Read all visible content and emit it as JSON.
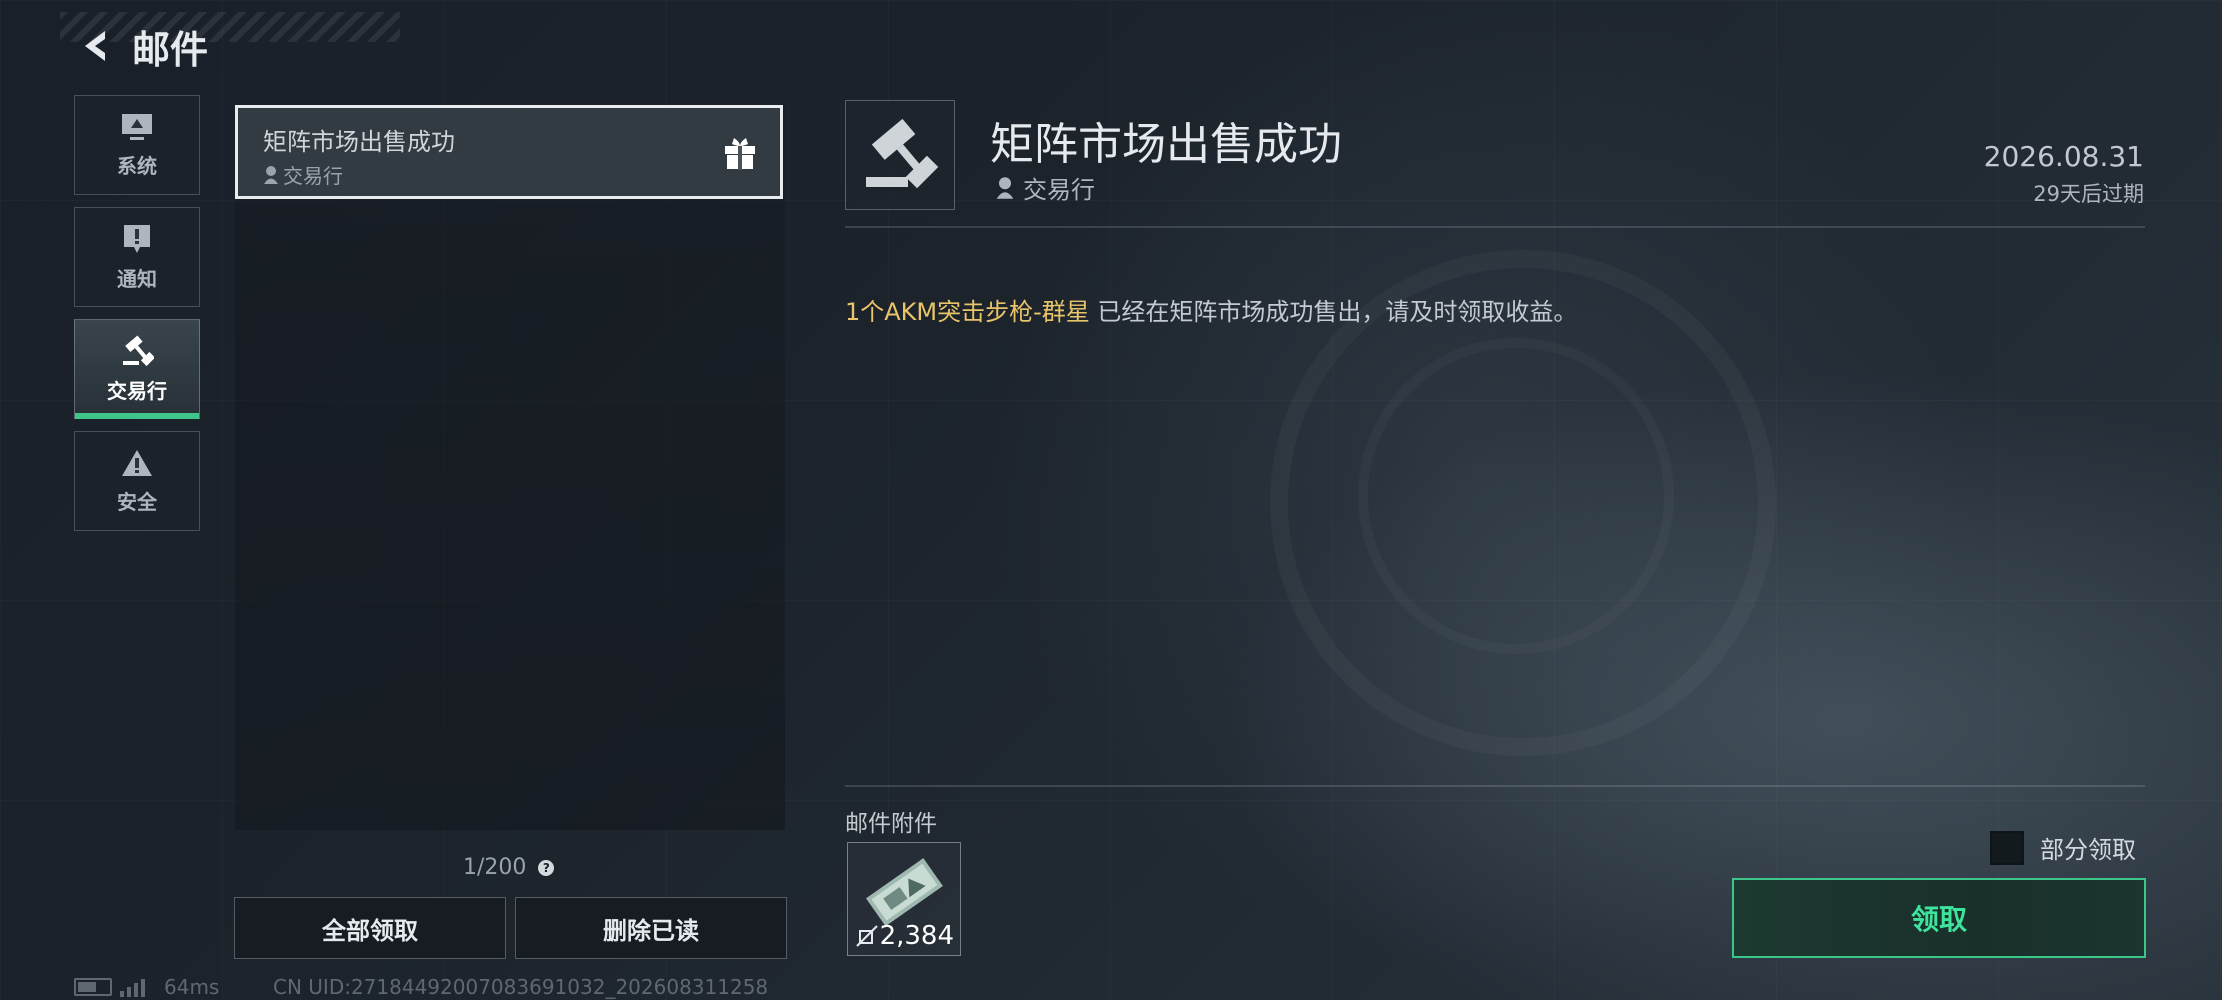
{
  "header": {
    "title": "邮件"
  },
  "nav": {
    "items": [
      {
        "label": "系统",
        "icon": "monitor-icon"
      },
      {
        "label": "通知",
        "icon": "alert-bubble-icon"
      },
      {
        "label": "交易行",
        "icon": "gavel-icon",
        "active": true
      },
      {
        "label": "安全",
        "icon": "warning-icon"
      }
    ]
  },
  "mail_list": {
    "items": [
      {
        "subject": "矩阵市场出售成功",
        "sender": "交易行",
        "icon": "gift-icon"
      }
    ],
    "count": "1/200"
  },
  "buttons": {
    "claim_all": "全部领取",
    "delete_read": "删除已读",
    "claim": "领取"
  },
  "detail": {
    "title": "矩阵市场出售成功",
    "sender": "交易行",
    "date": "2026.08.31",
    "expire": "29天后过期",
    "body_highlight": "1个AKM突击步枪-群星",
    "body_rest": " 已经在矩阵市场成功售出，请及时领取收益。",
    "attachment_label": "邮件附件",
    "attachment_count": "2,384",
    "partial_claim_label": "部分领取"
  },
  "status_bar": {
    "ping": "64ms",
    "uid": "CN UID:2718449200708369103​2_202608311258"
  },
  "colors": {
    "accent": "#3ec58a",
    "highlight": "#e8c46a"
  }
}
